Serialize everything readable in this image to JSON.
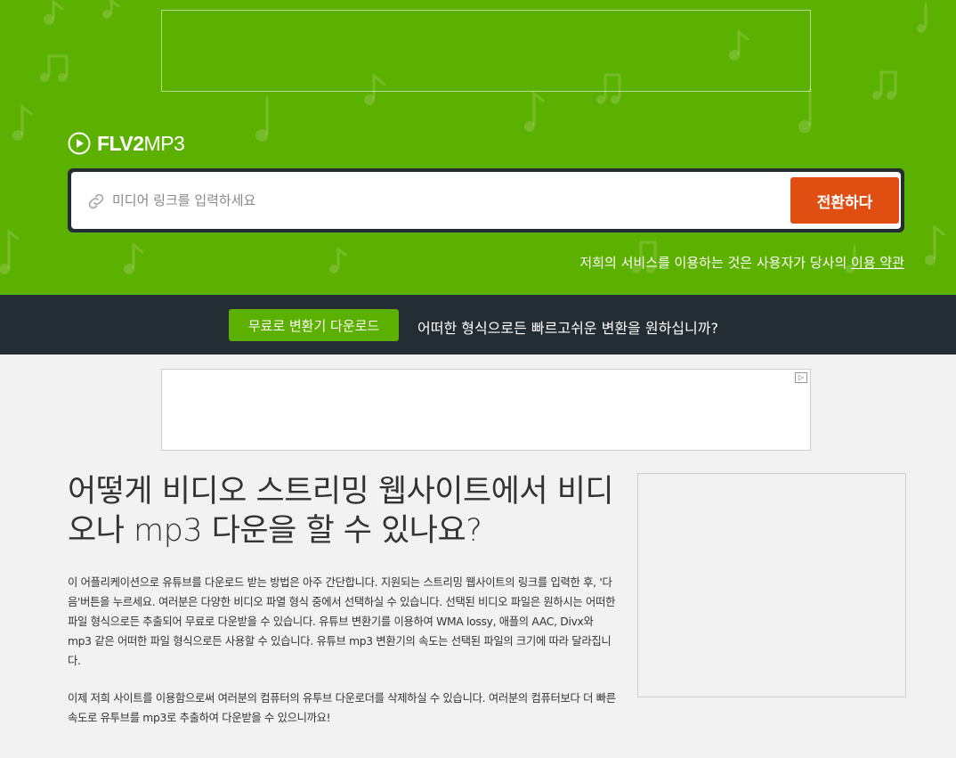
{
  "logo": {
    "bold": "FLV2",
    "light": "MP3"
  },
  "search": {
    "placeholder": "미디어 링크를 입력하세요",
    "value": "",
    "button_label": "전환하다"
  },
  "terms": {
    "text": "저희의 서비스를 이용하는 것은 사용자가 당사의 ",
    "link": "이용 약관"
  },
  "promo": {
    "button_label": "무료로 변환기 다운로드",
    "text": "어떠한 형식으로든 빠르고쉬운 변환을 원하십니까?"
  },
  "content": {
    "heading": "어떻게 비디오 스트리밍 웹사이트에서 비디오나 mp3 다운을 할 수 있나요?",
    "paragraph1": "이 어플리케이션으로 유튜브를 다운로드 받는 방법은 아주 간단합니다. 지원되는 스트리밍 웹사이트의 링크를 입력한 후, '다음'버튼을 누르세요. 여러분은 다양한 비디오 파열 형식 중에서 선택하실 수 있습니다. 선택된 비디오 파일은 원하시는 어떠한 파일 형식으로든 추출되어 무료로 다운받을 수 있습니다. 유튜브 변환기를 이용하여 WMA lossy, 애플의 AAC, Divx와 mp3 같은 어떠한 파일 형식으로든 사용할 수 있습니다. 유튜브 mp3 변환기의 속도는 선택된 파일의 크기에 따라 달라집니다.",
    "paragraph2": "이제 저희 사이트를 이용함으로써 여러분의 컴퓨터의 유투브 다운로더를 삭제하실 수 있습니다. 여러분의 컴퓨터보다 더 빠른 속도로 유투브를 mp3로 추출하여 다운받을 수 있으니까요!"
  },
  "icons": {
    "logo": "play-circle-icon",
    "link": "link-icon",
    "ad": "ad-choices-icon"
  },
  "colors": {
    "hero_bg": "#5cb000",
    "dark_bar": "#232d33",
    "convert_button": "#e04e12",
    "promo_button": "#5cb000"
  }
}
